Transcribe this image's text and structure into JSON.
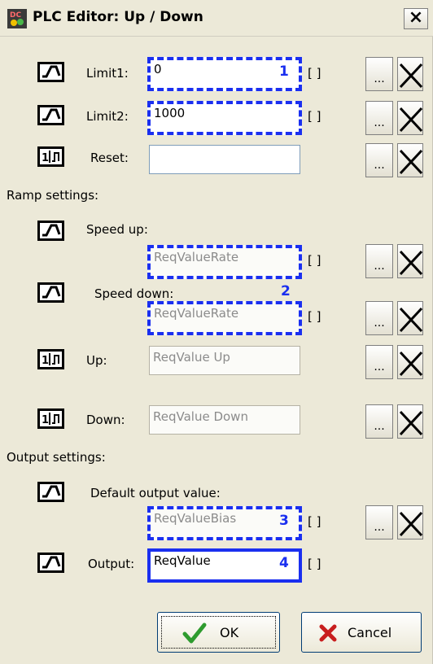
{
  "window": {
    "title": "PLC Editor: Up / Down",
    "close_label": "×"
  },
  "rows": [
    {
      "key": "limit1",
      "icon": "analog-signal-icon",
      "label": "Limit1:",
      "value": "0",
      "placeholder": "",
      "unit": "[ ]",
      "badge": "1",
      "style": "dashed"
    },
    {
      "key": "limit2",
      "icon": "analog-signal-icon",
      "label": "Limit2:",
      "value": "1000",
      "placeholder": "",
      "unit": "[ ]",
      "badge": "",
      "style": "dashed"
    },
    {
      "key": "reset",
      "icon": "digital-signal-icon",
      "label": "Reset:",
      "value": "",
      "placeholder": "",
      "unit": "",
      "badge": "",
      "style": "plain"
    },
    {
      "key": "speed_up",
      "icon": "analog-signal-icon",
      "label": "Speed up:",
      "value": "",
      "placeholder": "ReqValueRate",
      "unit": "[ ]",
      "badge": "",
      "style": "dashed"
    },
    {
      "key": "speed_down",
      "icon": "analog-signal-icon",
      "label": "Speed down:",
      "value": "",
      "placeholder": "ReqValueRate",
      "unit": "[ ]",
      "badge": "2",
      "style": "dashed"
    },
    {
      "key": "up",
      "icon": "digital-signal-icon",
      "label": "Up:",
      "value": "",
      "placeholder": "ReqValue Up",
      "unit": "",
      "badge": "",
      "style": "plain"
    },
    {
      "key": "down",
      "icon": "digital-signal-icon",
      "label": "Down:",
      "value": "",
      "placeholder": "ReqValue Down",
      "unit": "",
      "badge": "",
      "style": "plain"
    },
    {
      "key": "default_output",
      "icon": "analog-signal-icon",
      "label": "Default output value:",
      "value": "",
      "placeholder": "ReqValueBias",
      "unit": "[ ]",
      "badge": "3",
      "style": "dashed"
    },
    {
      "key": "output",
      "icon": "analog-signal-icon",
      "label": "Output:",
      "value": "ReqValue",
      "placeholder": "",
      "unit": "[ ]",
      "badge": "4",
      "style": "solid"
    }
  ],
  "sections": {
    "ramp": "Ramp settings:",
    "output": "Output settings:"
  },
  "buttons": {
    "dots": "...",
    "ok": "OK",
    "cancel": "Cancel"
  },
  "colors": {
    "highlight": "#1a2ff0",
    "ok_check": "#2e9b2e",
    "cancel_x": "#c81e1e"
  }
}
